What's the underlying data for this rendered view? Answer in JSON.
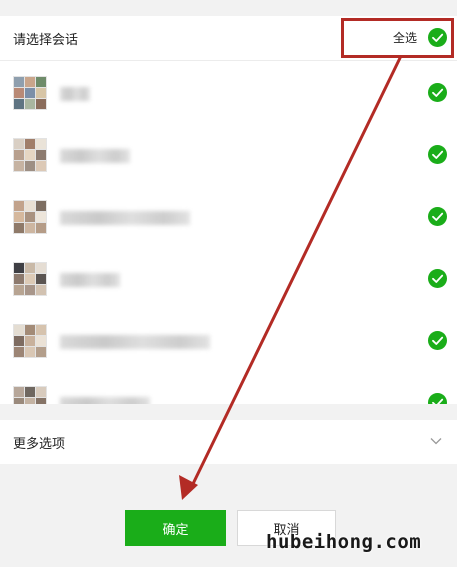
{
  "header": {
    "title": "请选择会话",
    "select_all_label": "全选",
    "select_all_checked": true
  },
  "conversations": [
    {
      "name_blurred": true,
      "selected": true,
      "avatar_icon": "group-avatar-icon"
    },
    {
      "name_blurred": true,
      "selected": true,
      "avatar_icon": "group-avatar-icon"
    },
    {
      "name_blurred": true,
      "selected": true,
      "avatar_icon": "group-avatar-icon"
    },
    {
      "name_blurred": true,
      "selected": true,
      "avatar_icon": "group-avatar-icon"
    },
    {
      "name_blurred": true,
      "selected": true,
      "avatar_icon": "group-avatar-icon"
    },
    {
      "name_blurred": true,
      "selected": true,
      "avatar_icon": "group-avatar-icon"
    }
  ],
  "more_options": {
    "label": "更多选项",
    "icon": "chevron-down-icon"
  },
  "buttons": {
    "confirm_label": "确定",
    "cancel_label": "取消"
  },
  "watermark": "hubeihong.com",
  "colors": {
    "accent_green": "#1aad19",
    "annotation_red": "#b32b25",
    "background": "#f2f2f2",
    "panel": "#ffffff"
  }
}
